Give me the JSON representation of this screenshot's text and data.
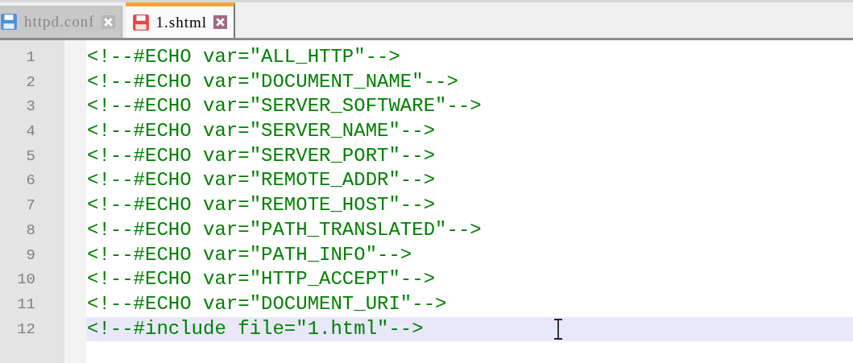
{
  "tabs": [
    {
      "label": "httpd.conf",
      "selected": false,
      "color": "#4a90d9"
    },
    {
      "label": "1.shtml",
      "selected": true,
      "color": "#e8474a"
    }
  ],
  "lines": [
    {
      "number": "1",
      "code": "<!--#ECHO var=\"ALL_HTTP\"-->",
      "current": false
    },
    {
      "number": "2",
      "code": "<!--#ECHO var=\"DOCUMENT_NAME\"-->",
      "current": false
    },
    {
      "number": "3",
      "code": "<!--#ECHO var=\"SERVER_SOFTWARE\"-->",
      "current": false
    },
    {
      "number": "4",
      "code": "<!--#ECHO var=\"SERVER_NAME\"-->",
      "current": false
    },
    {
      "number": "5",
      "code": "<!--#ECHO var=\"SERVER_PORT\"-->",
      "current": false
    },
    {
      "number": "6",
      "code": "<!--#ECHO var=\"REMOTE_ADDR\"-->",
      "current": false
    },
    {
      "number": "7",
      "code": "<!--#ECHO var=\"REMOTE_HOST\"-->",
      "current": false
    },
    {
      "number": "8",
      "code": "<!--#ECHO var=\"PATH_TRANSLATED\"-->",
      "current": false
    },
    {
      "number": "9",
      "code": "<!--#ECHO var=\"PATH_INFO\"-->",
      "current": false
    },
    {
      "number": "10",
      "code": "<!--#ECHO var=\"HTTP_ACCEPT\"-->",
      "current": false
    },
    {
      "number": "11",
      "code": "<!--#ECHO var=\"DOCUMENT_URI\"-->",
      "current": false
    },
    {
      "number": "12",
      "code": "<!--#include file=\"1.html\"-->",
      "current": true
    }
  ]
}
